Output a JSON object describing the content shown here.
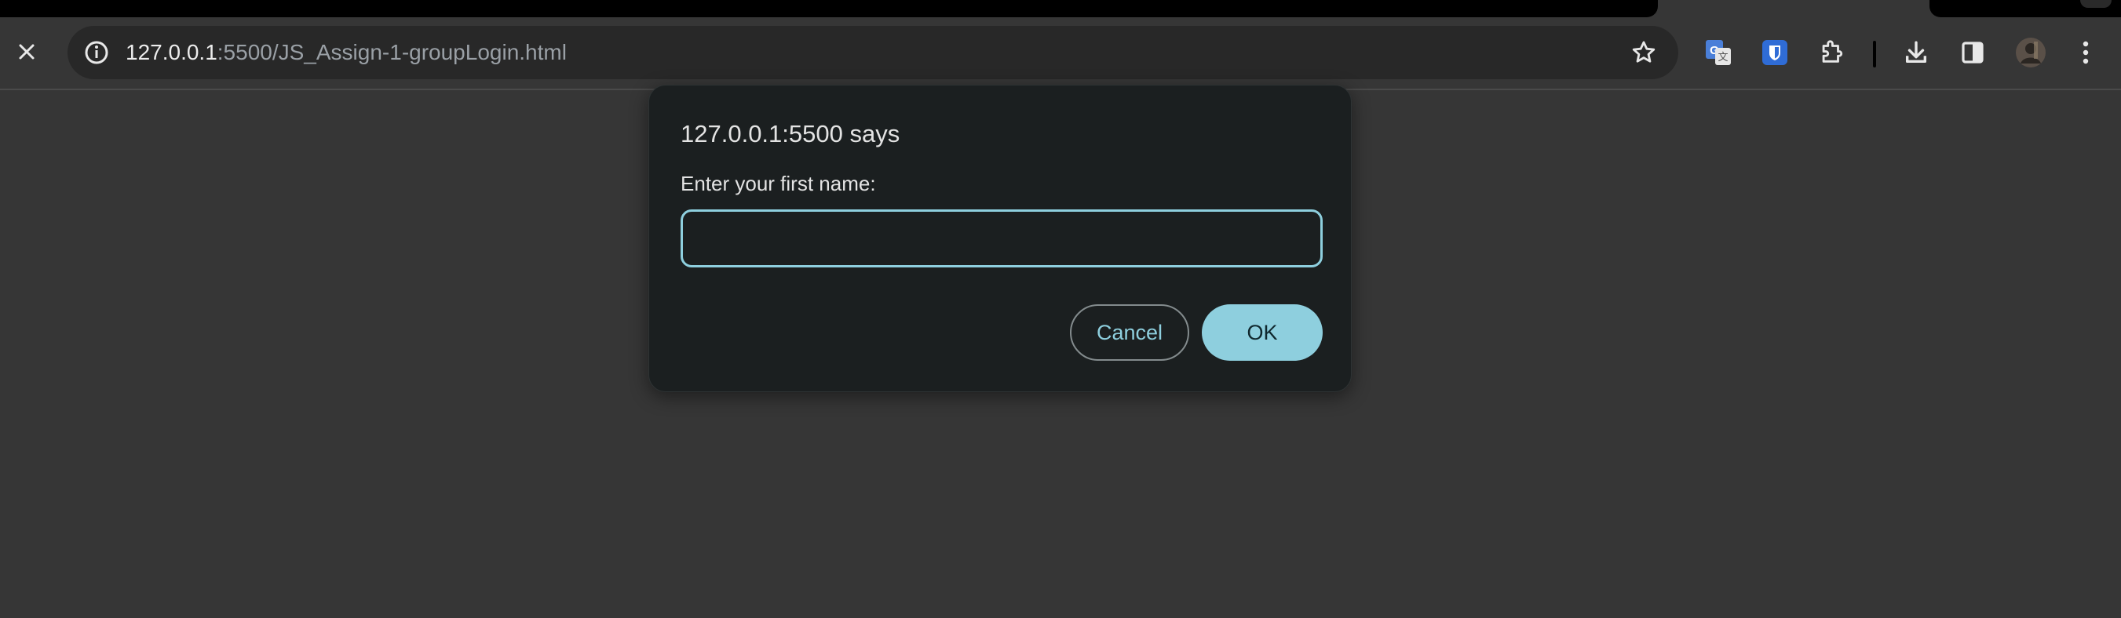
{
  "browser": {
    "url_host": "127.0.0.1",
    "url_rest": ":5500/JS_Assign-1-groupLogin.html",
    "icons": {
      "close": "close-icon",
      "info": "info-icon",
      "bookmark": "star-icon",
      "translate": "google-translate-icon",
      "bitwarden": "bitwarden-shield-icon",
      "extensions": "puzzle-piece-icon",
      "downloads": "download-icon",
      "side_panel": "side-panel-icon",
      "profile": "profile-avatar",
      "menu": "more-vert-icon"
    }
  },
  "dialog": {
    "title": "127.0.0.1:5500 says",
    "message": "Enter your first name:",
    "input_value": "",
    "cancel_label": "Cancel",
    "ok_label": "OK"
  },
  "colors": {
    "accent": "#8ecfde",
    "dialog_bg": "#1b1f20",
    "page_bg": "#363636"
  }
}
